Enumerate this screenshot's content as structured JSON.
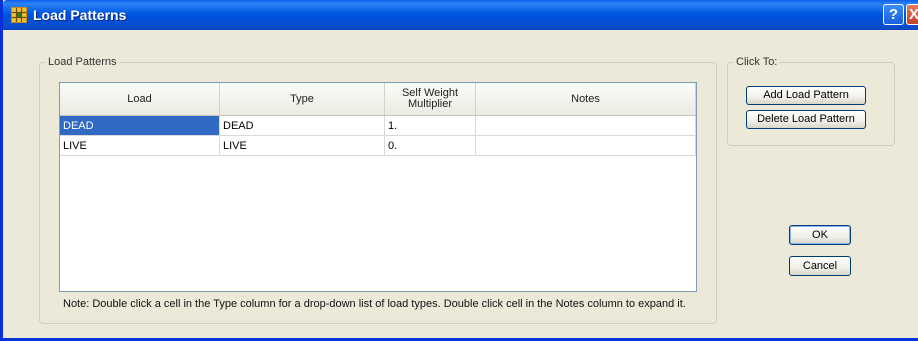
{
  "window": {
    "title": "Load Patterns",
    "help_label": "?",
    "close_label": "X"
  },
  "load_patterns_group": {
    "legend": "Load Patterns",
    "columns": [
      "Load",
      "Type",
      "Self Weight Multiplier",
      "Notes"
    ],
    "rows": [
      {
        "load": "DEAD",
        "type": "DEAD",
        "multiplier": "1.",
        "notes": ""
      },
      {
        "load": "LIVE",
        "type": "LIVE",
        "multiplier": "0.",
        "notes": ""
      }
    ],
    "selected_cell": "DEAD",
    "note": "Note:  Double click a cell in the Type column for a drop-down list of load types.  Double click cell in the Notes column to expand it."
  },
  "click_to_group": {
    "legend": "Click To:",
    "add_label": "Add Load Pattern",
    "delete_label": "Delete Load Pattern"
  },
  "dialog_buttons": {
    "ok_label": "OK",
    "cancel_label": "Cancel"
  },
  "colors": {
    "titlebar": "#0058e0",
    "selection": "#316ac5",
    "face": "#ece9d8"
  }
}
